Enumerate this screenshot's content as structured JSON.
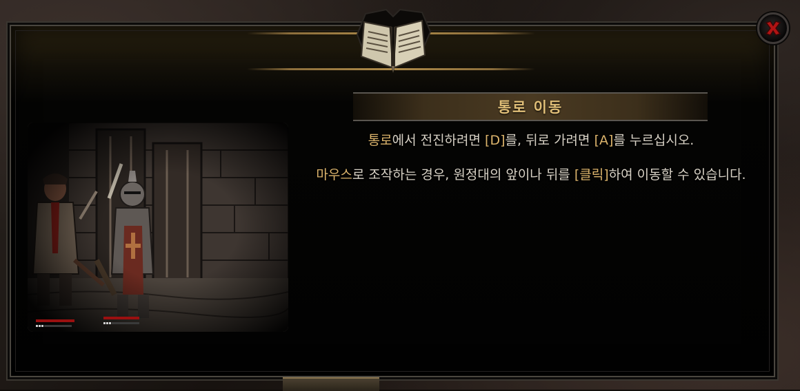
{
  "dialog": {
    "title": "통로 이동",
    "line1": {
      "kw1": "통로",
      "t1": "에서 전진하려면 ",
      "kw2": "[D]",
      "t2": "를, 뒤로 가려면 ",
      "kw3": "[A]",
      "t3": "를 누르십시오."
    },
    "line2": {
      "kw1": "마우스",
      "t1": "로 조작하는 경우, 원정대의 앞이나 뒤를 ",
      "kw2": "[클릭]",
      "t2": "하여 이동할 수 있습니다."
    }
  },
  "icons": {
    "header": "open-book-icon",
    "close": "close-x-icon"
  },
  "colors": {
    "highlight": "#dcb46c",
    "body_text": "#d8d2c6",
    "close_x": "#b01414"
  }
}
